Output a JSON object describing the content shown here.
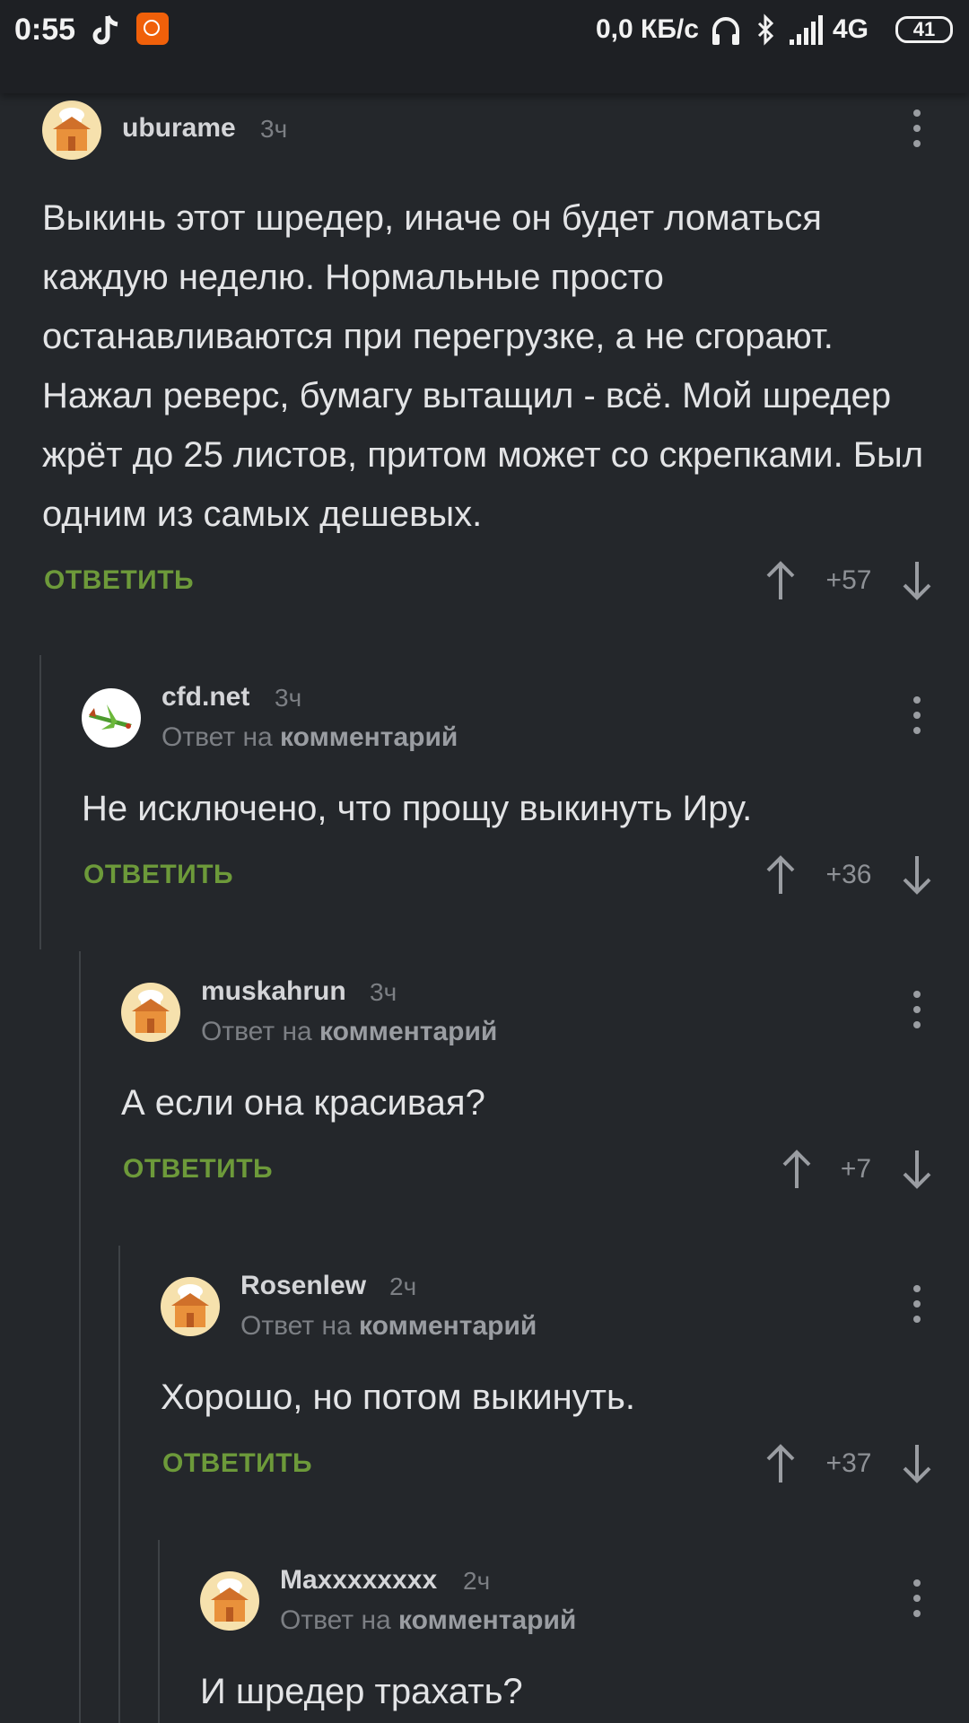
{
  "status_bar": {
    "time": "0:55",
    "speed": "0,0 КБ/с",
    "network": "4G",
    "battery": "41",
    "icons": [
      "tiktok-icon",
      "app-notification-icon",
      "headphones-icon",
      "bluetooth-icon",
      "signal-icon",
      "battery-icon"
    ]
  },
  "labels": {
    "reply_button": "ОТВЕТИТЬ",
    "reply_to_prefix": "Ответ на",
    "reply_to_target": "комментарий"
  },
  "colors": {
    "background": "#24272b",
    "reply_green": "#6d9a3a",
    "muted_text": "#7c7f84"
  },
  "comments": [
    {
      "author": "uburame",
      "time": "3ч",
      "text": "Выкинь этот шредер, иначе он будет ломаться каждую неделю. Нормальные просто останавливаются при перегрузке, а не сгорают. Нажал реверс, бумагу вытащил - всё. Мой шредер жрёт до 25 листов, притом может со скрепками. Был одним из самых дешевых.",
      "score": "+57",
      "avatar": "chef-house-avatar"
    },
    {
      "author": "cfd.net",
      "time": "3ч",
      "text": "Не исключено, что прощу выкинуть Иру.",
      "score": "+36",
      "avatar": "airplane-avatar"
    },
    {
      "author": "muskahrun",
      "time": "3ч",
      "text": "А если она красивая?",
      "score": "+7",
      "avatar": "chef-house-avatar"
    },
    {
      "author": "Rosenlew",
      "time": "2ч",
      "text": "Хорошо, но потом выкинуть.",
      "score": "+37",
      "avatar": "chef-house-avatar"
    },
    {
      "author": "Maxxxxxxxx",
      "time": "2ч",
      "text": "И шредер трахать?",
      "avatar": "chef-house-avatar"
    }
  ]
}
